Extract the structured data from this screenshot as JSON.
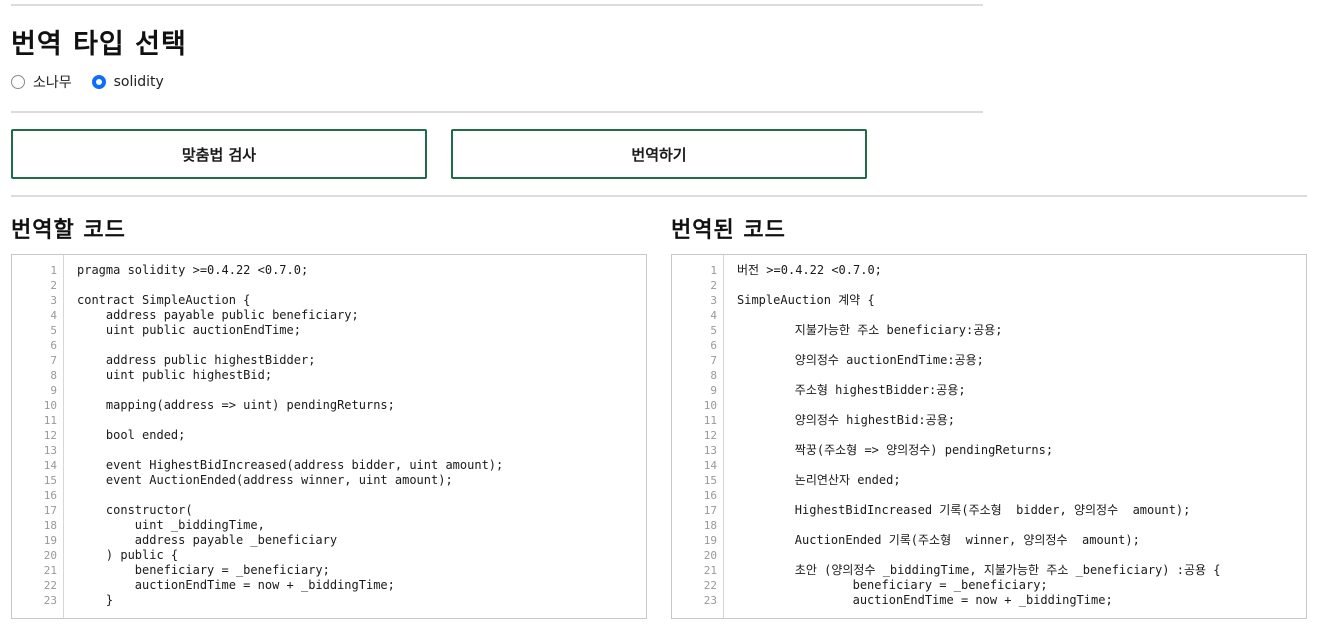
{
  "header": {
    "title": "번역 타입 선택"
  },
  "radio": {
    "options": [
      {
        "label": "소나무",
        "checked": false
      },
      {
        "label": "solidity",
        "checked": true
      }
    ]
  },
  "buttons": {
    "spell_check": "맞춤법 검사",
    "translate": "번역하기"
  },
  "source_pane": {
    "title": "번역할 코드",
    "lines": [
      "pragma solidity >=0.4.22 <0.7.0;",
      "",
      "contract SimpleAuction {",
      "    address payable public beneficiary;",
      "    uint public auctionEndTime;",
      "",
      "    address public highestBidder;",
      "    uint public highestBid;",
      "",
      "    mapping(address => uint) pendingReturns;",
      "",
      "    bool ended;",
      "",
      "    event HighestBidIncreased(address bidder, uint amount);",
      "    event AuctionEnded(address winner, uint amount);",
      "",
      "    constructor(",
      "        uint _biddingTime,",
      "        address payable _beneficiary",
      "    ) public {",
      "        beneficiary = _beneficiary;",
      "        auctionEndTime = now + _biddingTime;",
      "    }"
    ]
  },
  "result_pane": {
    "title": "번역된 코드",
    "lines": [
      "버전 >=0.4.22 <0.7.0;",
      "",
      "SimpleAuction 계약 {",
      "",
      "        지불가능한 주소 beneficiary:공용;",
      "",
      "        양의정수 auctionEndTime:공용;",
      "",
      "        주소형 highestBidder:공용;",
      "",
      "        양의정수 highestBid:공용;",
      "",
      "        짝꿍(주소형 => 양의정수) pendingReturns;",
      "",
      "        논리연산자 ended;",
      "",
      "        HighestBidIncreased 기록(주소형  bidder, 양의정수  amount);",
      "",
      "        AuctionEnded 기록(주소형  winner, 양의정수  amount);",
      "",
      "        초안 (양의정수 _biddingTime, 지불가능한 주소 _beneficiary) :공용 {",
      "                beneficiary = _beneficiary;",
      "                auctionEndTime = now + _biddingTime;"
    ]
  },
  "colors": {
    "button_border": "#1f6b4a",
    "radio_checked": "#0d6efd"
  }
}
